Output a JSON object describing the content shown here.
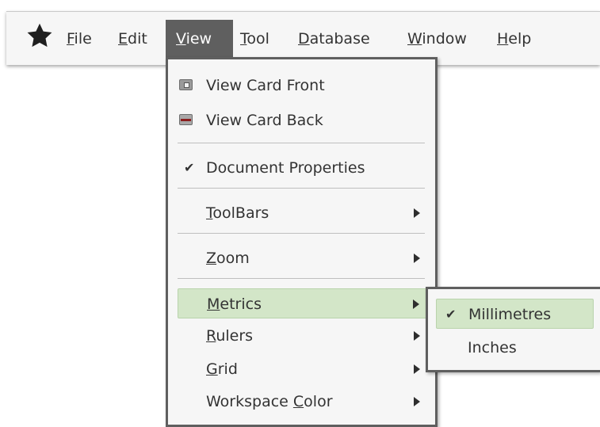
{
  "menubar": {
    "app_icon": "star-icon",
    "items": [
      {
        "label": "File",
        "access_key": "F",
        "rest": "ile"
      },
      {
        "label": "Edit",
        "access_key": "E",
        "rest": "dit"
      },
      {
        "label": "View",
        "access_key": "V",
        "rest": "iew",
        "active": true
      },
      {
        "label": "Tool",
        "access_key": "T",
        "rest": "ool"
      },
      {
        "label": "Database",
        "access_key": "D",
        "rest": "atabase"
      },
      {
        "label": "Window",
        "access_key": "W",
        "rest": "indow"
      },
      {
        "label": "Help",
        "access_key": "H",
        "rest": "elp"
      }
    ]
  },
  "view_menu": {
    "items": [
      {
        "label": "View Card Front",
        "icon": "card-front-icon"
      },
      {
        "label": "View Card Back",
        "icon": "card-back-icon"
      },
      {
        "label": "Document Properties",
        "checked": true,
        "check_glyph": "✔"
      },
      {
        "label": "ToolBars",
        "access_key": "T",
        "rest": "oolBars",
        "submenu": true
      },
      {
        "label": "Zoom",
        "access_key": "Z",
        "rest": "oom",
        "submenu": true
      },
      {
        "label": "Metrics",
        "access_key": "M",
        "rest": "etrics",
        "submenu": true,
        "highlighted": true
      },
      {
        "label": "Rulers",
        "access_key": "R",
        "rest": "ulers",
        "submenu": true
      },
      {
        "label": "Grid",
        "access_key": "G",
        "rest": "rid",
        "submenu": true
      },
      {
        "label": "Workspace Color",
        "prefix": "Workspace ",
        "access_key": "C",
        "rest": "olor",
        "submenu": true
      }
    ]
  },
  "metrics_submenu": {
    "items": [
      {
        "label": "Millimetres",
        "checked": true,
        "highlighted": true,
        "check_glyph": "✔"
      },
      {
        "label": "Inches",
        "checked": false
      }
    ]
  },
  "colors": {
    "menu_active_bg": "#5f5f5f",
    "highlight_bg": "#d3e6c8",
    "menu_bg": "#f6f6f6"
  }
}
